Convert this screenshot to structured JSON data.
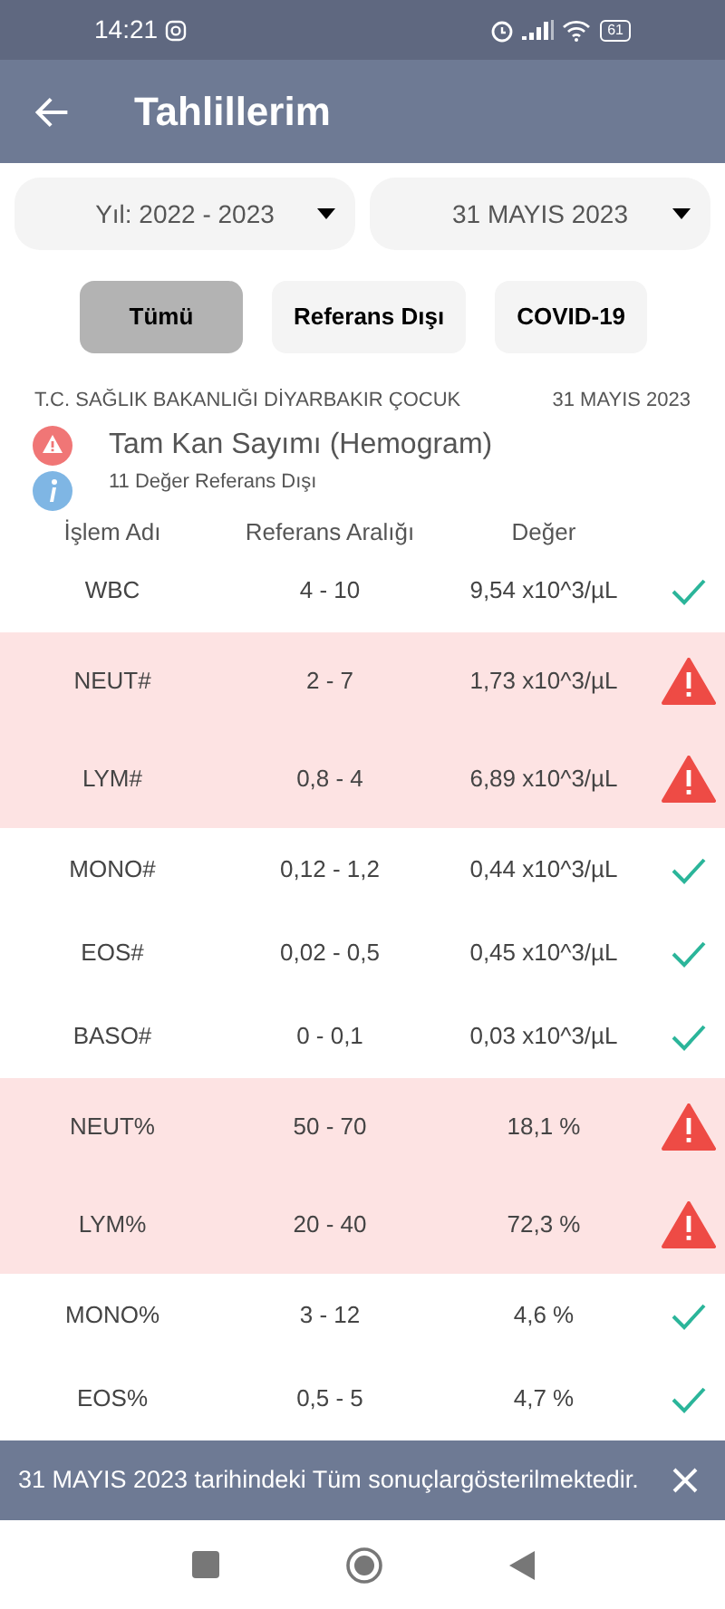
{
  "status_bar": {
    "time": "14:21",
    "battery": "61"
  },
  "app_bar": {
    "title": "Tahlillerim"
  },
  "filters": [
    {
      "value": "Yıl: 2022 - 2023"
    },
    {
      "value": "31 MAYIS 2023"
    }
  ],
  "tabs": [
    {
      "label": "Tümü",
      "selected": true
    },
    {
      "label": "Referans Dışı",
      "selected": false
    },
    {
      "label": "COVID-19",
      "selected": false
    }
  ],
  "report": {
    "institution": "T.C. SAĞLIK BAKANLIĞI DİYARBAKIR ÇOCUK",
    "date": "31 MAYIS 2023",
    "test_name": "Tam Kan Sayımı (Hemogram)",
    "summary": "11 Değer Referans Dışı"
  },
  "table": {
    "columns": [
      "İşlem Adı",
      "Referans Aralığı",
      "Değer"
    ],
    "rows": [
      {
        "name": "WBC",
        "range": "4 - 10",
        "value": "9,54 x10^3/µL",
        "out_of_range": false
      },
      {
        "name": "NEUT#",
        "range": "2 - 7",
        "value": "1,73 x10^3/µL",
        "out_of_range": true
      },
      {
        "name": "LYM#",
        "range": "0,8 - 4",
        "value": "6,89 x10^3/µL",
        "out_of_range": true
      },
      {
        "name": "MONO#",
        "range": "0,12 - 1,2",
        "value": "0,44 x10^3/µL",
        "out_of_range": false
      },
      {
        "name": "EOS#",
        "range": "0,02 - 0,5",
        "value": "0,45 x10^3/µL",
        "out_of_range": false
      },
      {
        "name": "BASO#",
        "range": "0 - 0,1",
        "value": "0,03 x10^3/µL",
        "out_of_range": false
      },
      {
        "name": "NEUT%",
        "range": "50 - 70",
        "value": "18,1 %",
        "out_of_range": true
      },
      {
        "name": "LYM%",
        "range": "20 - 40",
        "value": "72,3 %",
        "out_of_range": true
      },
      {
        "name": "MONO%",
        "range": "3 - 12",
        "value": "4,6 %",
        "out_of_range": false
      },
      {
        "name": "EOS%",
        "range": "0,5 - 5",
        "value": "4,7 %",
        "out_of_range": false
      }
    ]
  },
  "snackbar": {
    "message": "31 MAYIS 2023 tarihindeki Tüm sonuçlargösterilmektedir."
  }
}
